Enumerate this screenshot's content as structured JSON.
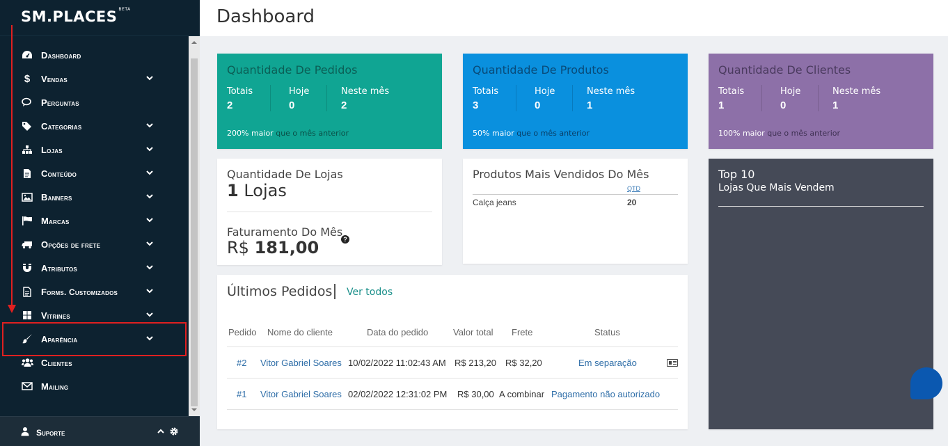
{
  "brand": {
    "logo": "SM.PLACES",
    "badge": "BETA"
  },
  "sidebar": {
    "items": [
      {
        "label": "Dashboard",
        "icon": "dashboard-icon",
        "chevron": false
      },
      {
        "label": "Vendas",
        "icon": "dollar-icon",
        "chevron": true
      },
      {
        "label": "Perguntas",
        "icon": "comments-icon",
        "chevron": false
      },
      {
        "label": "Categorias",
        "icon": "tags-icon",
        "chevron": true
      },
      {
        "label": "Lojas",
        "icon": "sitemap-icon",
        "chevron": true
      },
      {
        "label": "Conteúdo",
        "icon": "file-icon",
        "chevron": true
      },
      {
        "label": "Banners",
        "icon": "image-icon",
        "chevron": true
      },
      {
        "label": "Marcas",
        "icon": "flag-icon",
        "chevron": true
      },
      {
        "label": "Opções de frete",
        "icon": "truck-icon",
        "chevron": true
      },
      {
        "label": "Atributos",
        "icon": "magnet-icon",
        "chevron": true
      },
      {
        "label": "Forms. Customizados",
        "icon": "form-icon",
        "chevron": true
      },
      {
        "label": "Vitrines",
        "icon": "windows-icon",
        "chevron": true
      },
      {
        "label": "Aparência",
        "icon": "paint-brush-icon",
        "chevron": true
      },
      {
        "label": "Clientes",
        "icon": "users-icon",
        "chevron": false
      },
      {
        "label": "Mailing",
        "icon": "envelope-icon",
        "chevron": false
      }
    ],
    "support_label": "Suporte"
  },
  "header": {
    "title": "Dashboard"
  },
  "stats": {
    "pedidos": {
      "title": "Quantidade De Pedidos",
      "labels": [
        "Totais",
        "Hoje",
        "Neste mês"
      ],
      "values": [
        "2",
        "0",
        "2"
      ],
      "foot_bold": "200% maior",
      "foot_text": "que o mês anterior",
      "color": "#10a593"
    },
    "produtos": {
      "title": "Quantidade De Produtos",
      "labels": [
        "Totais",
        "Hoje",
        "Neste mês"
      ],
      "values": [
        "3",
        "0",
        "1"
      ],
      "foot_bold": "50% maior",
      "foot_text": "que o mês anterior",
      "color": "#0a90de"
    },
    "clientes": {
      "title": "Quantidade De Clientes",
      "labels": [
        "Totais",
        "Hoje",
        "Neste mês"
      ],
      "values": [
        "1",
        "0",
        "1"
      ],
      "foot_bold": "100% maior",
      "foot_text": "que o mês anterior",
      "color": "#8d70a8"
    }
  },
  "lojas": {
    "title": "Quantidade De Lojas",
    "count": "1",
    "count_unit": "Lojas",
    "fat_title": "Faturamento Do Mês",
    "fat_currency": "R$",
    "fat_value": "181,00"
  },
  "produtos_vendidos": {
    "title": "Produtos Mais Vendidos Do Mês",
    "qtd_header": "QTD",
    "rows": [
      {
        "name": "Calça jeans",
        "qtd": "20"
      }
    ]
  },
  "top10": {
    "title": "Top 10",
    "subtitle": "Lojas Que Mais Vendem"
  },
  "orders": {
    "title": "Últimos Pedidos",
    "link": "Ver todos",
    "headers": [
      "Pedido",
      "Nome do cliente",
      "Data do pedido",
      "Valor total",
      "Frete",
      "Status"
    ],
    "rows": [
      {
        "id": "#2",
        "client": "Vitor Gabriel Soares",
        "date": "10/02/2022 11:02:43 AM",
        "total": "R$ 213,20",
        "frete": "R$ 32,20",
        "status": "Em separação"
      },
      {
        "id": "#1",
        "client": "Vitor Gabriel Soares",
        "date": "02/02/2022 12:31:02 PM",
        "total": "R$ 30,00",
        "frete": "A combinar",
        "status": "Pagamento não autorizado"
      }
    ]
  }
}
